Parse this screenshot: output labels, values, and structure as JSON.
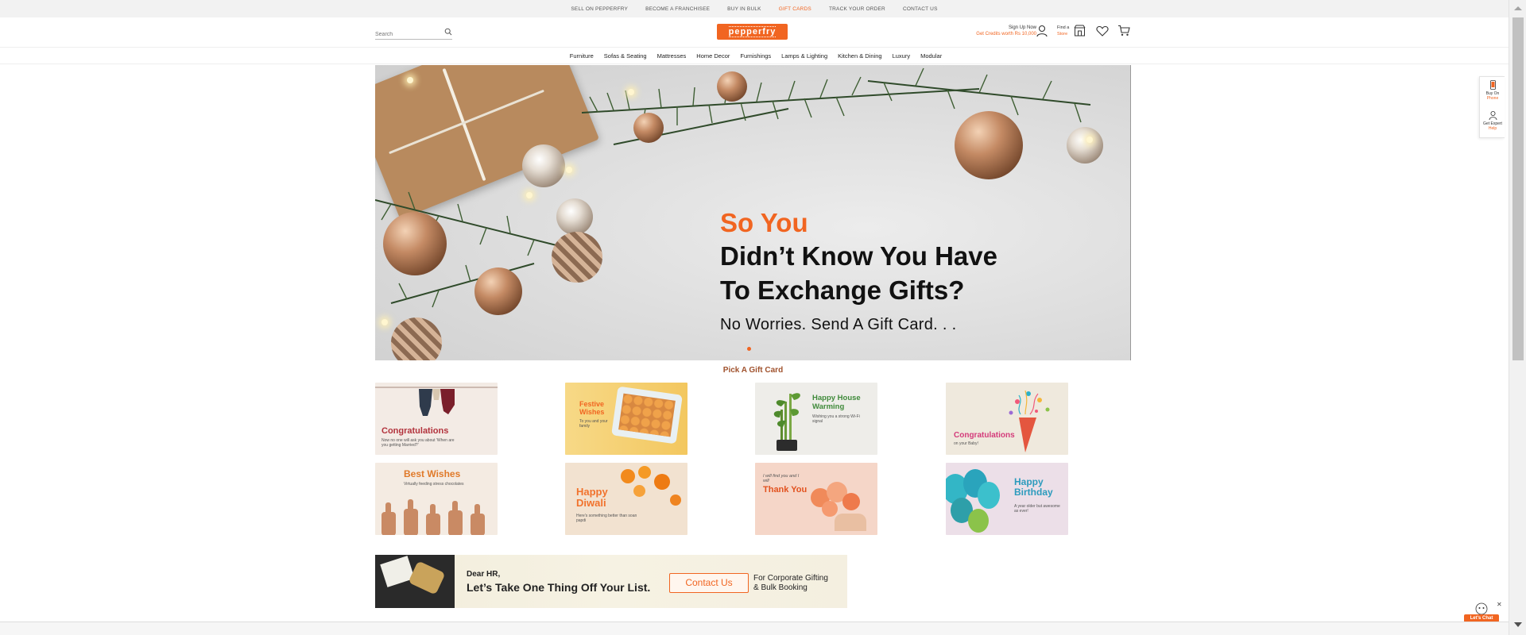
{
  "topbar": {
    "links": [
      "SELL ON PEPPERFRY",
      "BECOME A FRANCHISEE",
      "BUY IN BULK",
      "GIFT CARDS",
      "TRACK YOUR ORDER",
      "CONTACT US"
    ],
    "active": "GIFT CARDS"
  },
  "header": {
    "search_placeholder": "Search",
    "logo": "pepperfry",
    "signup": "Sign Up Now",
    "credits": "Get Credits worth Rs 10,000",
    "find_store_line1": "Find a",
    "find_store_line2": "Store"
  },
  "nav": {
    "items": [
      "Furniture",
      "Sofas & Seating",
      "Mattresses",
      "Home Decor",
      "Furnishings",
      "Lamps & Lighting",
      "Kitchen & Dining",
      "Luxury",
      "Modular"
    ]
  },
  "banner": {
    "line1": "So You",
    "line2": "Didn’t Know You Have",
    "line3": "To Exchange Gifts?",
    "line4": "No Worries. Send A Gift Card. . ."
  },
  "gift_section": {
    "title": "Pick A Gift Card",
    "cards": [
      {
        "title": "Congratulations",
        "subtitle": "Now no one will ask you about 'When are you getting Married?'",
        "color": "#b2323c"
      },
      {
        "title": "Festive Wishes",
        "subtitle": "To you and your family",
        "color": "#f16521"
      },
      {
        "title": "Happy House Warming",
        "subtitle": "Wishing you a strong Wi-Fi signal",
        "color": "#3f8a3a"
      },
      {
        "title": "Congratulations",
        "subtitle": "on your Baby!",
        "color": "#d43b7a"
      },
      {
        "title": "Best Wishes",
        "subtitle": "Virtually feeding stress chocolates",
        "color": "#e07a2a"
      },
      {
        "title": "Happy Diwali",
        "subtitle": "Here's something better than soan papdi",
        "color": "#f1722c"
      },
      {
        "title": "Thank You",
        "subtitle": "I will find you and I will",
        "color": "#e2521f"
      },
      {
        "title": "Happy Birthday",
        "subtitle": "A year older but awesome as ever!",
        "color": "#2c9bbd"
      }
    ]
  },
  "corporate": {
    "dear": "Dear HR,",
    "tagline": "Let’s Take One Thing Off Your List.",
    "cta": "Contact Us",
    "for_line1": "For Corporate Gifting",
    "for_line2": "& Bulk Booking"
  },
  "side_widgets": {
    "buy_line1": "Buy On",
    "buy_line2": "Phone",
    "help_line1": "Get Expert",
    "help_line2": "Help"
  },
  "chat": {
    "label": "Let's Chat"
  },
  "colors": {
    "accent": "#f16521"
  }
}
